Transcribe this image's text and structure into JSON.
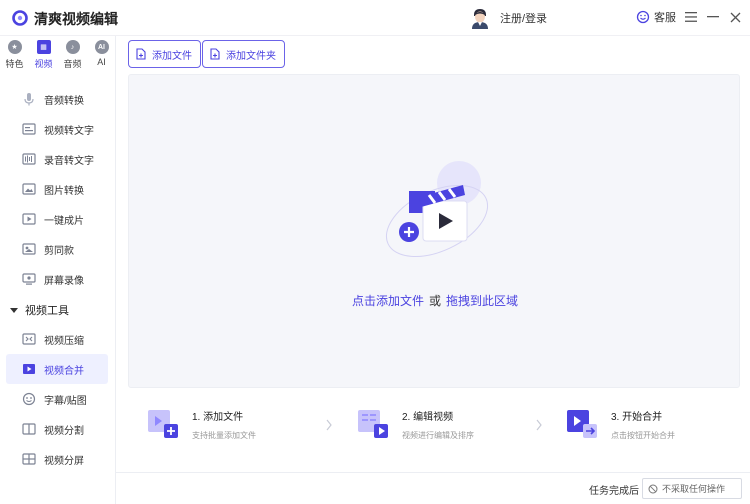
{
  "app": {
    "title": "清爽视频编辑"
  },
  "header": {
    "login_label": "注册/登录",
    "service_label": "客服"
  },
  "sidebar": {
    "categories": [
      {
        "label": "特色",
        "icon": "star-icon"
      },
      {
        "label": "视频",
        "icon": "film-icon"
      },
      {
        "label": "音频",
        "icon": "audio-icon"
      },
      {
        "label": "AI",
        "icon": "ai-icon"
      }
    ],
    "items": [
      {
        "label": "音频转换",
        "icon": "microphone-icon"
      },
      {
        "label": "视频转文字",
        "icon": "video-text-icon"
      },
      {
        "label": "录音转文字",
        "icon": "recording-text-icon"
      },
      {
        "label": "图片转换",
        "icon": "image-icon"
      },
      {
        "label": "一键成片",
        "icon": "play-icon"
      },
      {
        "label": "剪同款",
        "icon": "template-icon"
      },
      {
        "label": "屏幕录像",
        "icon": "screen-record-icon"
      }
    ],
    "section_title": "视频工具",
    "tools": [
      {
        "label": "视频压缩",
        "icon": "compress-icon"
      },
      {
        "label": "视频合并",
        "icon": "merge-icon",
        "active": true
      },
      {
        "label": "字幕/贴图",
        "icon": "subtitle-icon"
      },
      {
        "label": "视频分割",
        "icon": "split-icon"
      },
      {
        "label": "视频分屏",
        "icon": "split-screen-icon"
      }
    ]
  },
  "toolbar": {
    "add_file": "添加文件",
    "add_folder": "添加文件夹"
  },
  "dropzone": {
    "text_a": "点击添加文件",
    "text_or": "或",
    "text_b": "拖拽到此区域"
  },
  "steps": [
    {
      "title": "1. 添加文件",
      "desc": "支持批量添加文件"
    },
    {
      "title": "2. 编辑视频",
      "desc": "视频进行编辑及排序"
    },
    {
      "title": "3. 开始合并",
      "desc": "点击按钮开始合并"
    }
  ],
  "footer": {
    "label": "任务完成后",
    "option": "不采取任何操作"
  },
  "colors": {
    "accent": "#4b43e0",
    "accent_light": "#8f88ff",
    "panel_bg": "#f5f6fa"
  }
}
